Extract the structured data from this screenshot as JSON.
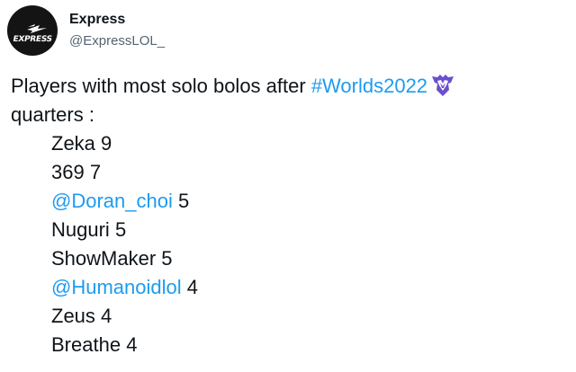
{
  "account": {
    "display_name": "Express",
    "handle": "@ExpressLOL_",
    "avatar_text": "EXPRESS"
  },
  "tweet": {
    "intro_text": "Players with most solo bolos after ",
    "hashtag": "#Worlds2022",
    "intro_line2": "quarters :",
    "emoji": "worlds-trophy-emoji",
    "players": [
      {
        "mention": "",
        "name": "Zeka",
        "count": "9"
      },
      {
        "mention": "",
        "name": "369",
        "count": "7"
      },
      {
        "mention": "@Doran_choi",
        "name": "",
        "count": "5"
      },
      {
        "mention": "",
        "name": "Nuguri",
        "count": "5"
      },
      {
        "mention": "",
        "name": "ShowMaker",
        "count": "5"
      },
      {
        "mention": "@Humanoidlol",
        "name": "",
        "count": "4"
      },
      {
        "mention": "",
        "name": "Zeus",
        "count": "4"
      },
      {
        "mention": "",
        "name": "Breathe",
        "count": "4"
      }
    ]
  },
  "colors": {
    "text": "#0f1419",
    "secondary": "#536471",
    "link": "#1d9bf0",
    "emoji": "#6a4fcf"
  }
}
